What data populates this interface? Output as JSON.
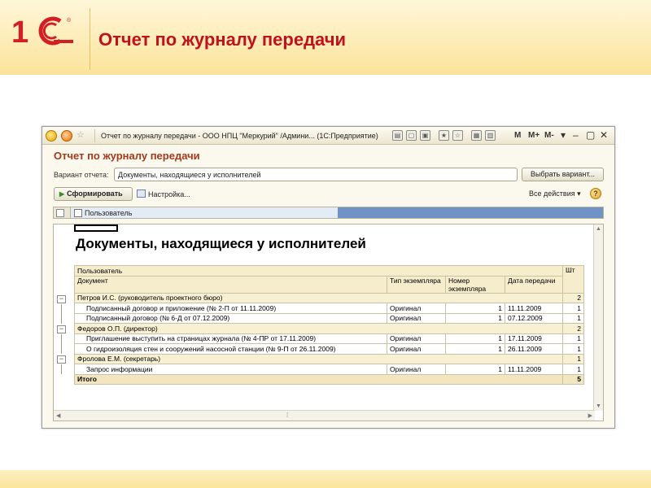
{
  "slide": {
    "title": "Отчет по журналу передачи"
  },
  "window": {
    "title": "Отчет по журналу передачи - ООО НПЦ \"Меркурий\" /Админи...  (1С:Предприятие)",
    "m_buttons": [
      "M",
      "M+",
      "M-"
    ],
    "form_title": "Отчет по журналу передачи",
    "variant_label": "Вариант отчета:",
    "variant_value": "Документы, находящиеся у исполнителей",
    "select_variant_button": "Выбрать вариант...",
    "build_button": "Сформировать",
    "settings_link": "Настройка...",
    "all_actions": "Все действия",
    "filter_field": "Пользователь"
  },
  "report": {
    "title": "Документы, находящиеся у исполнителей",
    "header": {
      "user": "Пользователь",
      "document": "Документ",
      "copy_type": "Тип экземпляра",
      "copy_number": "Номер экземпляра",
      "transfer_date": "Дата передачи",
      "count": "Шт"
    },
    "rows": [
      {
        "level": 0,
        "text": "Петров И.С. (руководитель проектного бюро)",
        "type": "",
        "num": "",
        "date": "",
        "count": "2"
      },
      {
        "level": 1,
        "text": "Подписанный договор и приложение (№ 2-П от 11.11.2009)",
        "type": "Оригинал",
        "num": "1",
        "date": "11.11.2009",
        "count": "1"
      },
      {
        "level": 1,
        "text": "Подписанный договор (№ 6-Д от 07.12.2009)",
        "type": "Оригинал",
        "num": "1",
        "date": "07.12.2009",
        "count": "1"
      },
      {
        "level": 0,
        "text": "Федоров О.П. (директор)",
        "type": "",
        "num": "",
        "date": "",
        "count": "2"
      },
      {
        "level": 1,
        "text": "Приглашение выступить на страницах журнала (№ 4-ПР от 17.11.2009)",
        "type": "Оригинал",
        "num": "1",
        "date": "17.11.2009",
        "count": "1"
      },
      {
        "level": 1,
        "text": "О гидроизоляция стен и сооружений насосной станции (№ 9-П от 26.11.2009)",
        "type": "Оригинал",
        "num": "1",
        "date": "26.11.2009",
        "count": "1"
      },
      {
        "level": 0,
        "text": "Фролова Е.М. (секретарь)",
        "type": "",
        "num": "",
        "date": "",
        "count": "1"
      },
      {
        "level": 1,
        "text": "Запрос информации",
        "type": "Оригинал",
        "num": "1",
        "date": "11.11.2009",
        "count": "1"
      }
    ],
    "total_label": "Итого",
    "total_count": "5"
  },
  "colors": {
    "slide_title": "#c0121c",
    "form_title": "#a5391a",
    "header_fill": "#f5edcc",
    "filter_accent": "#6f92c7"
  }
}
